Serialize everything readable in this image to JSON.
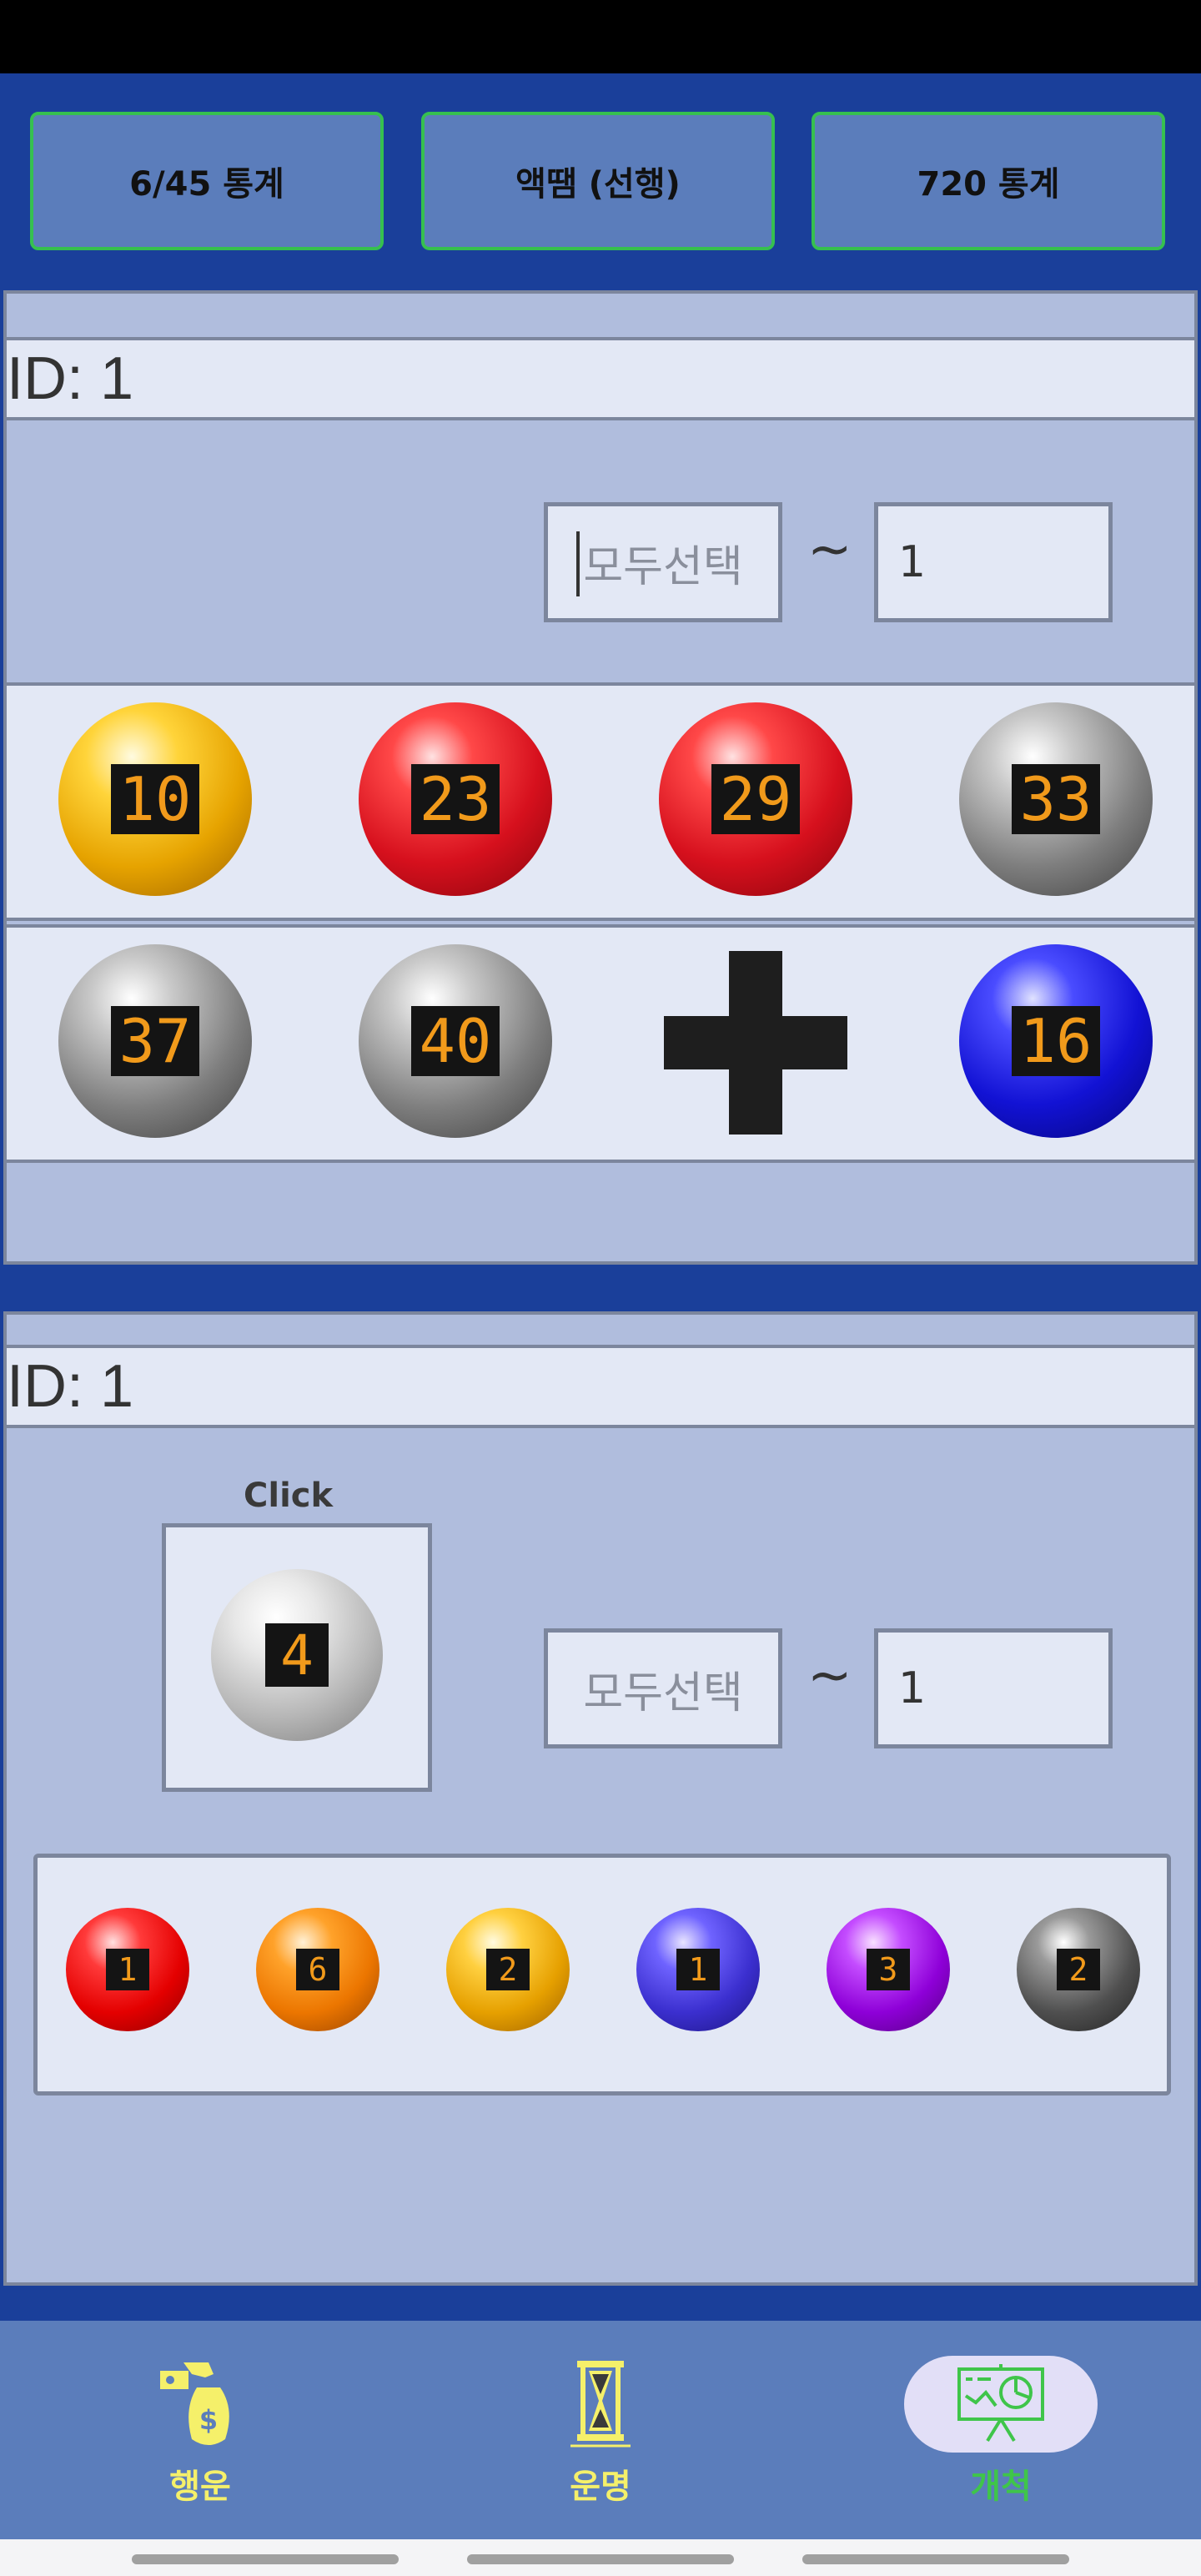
{
  "tabs": {
    "tab1": "6/45 통계",
    "tab2": "액땜 (선행)",
    "tab3": "720 통계"
  },
  "panel1": {
    "id_text": "ID: 1",
    "select_placeholder": "모두선택",
    "tilde": "~",
    "count_value": "1",
    "row1": [
      {
        "num": "10",
        "color": "gold"
      },
      {
        "num": "23",
        "color": "red"
      },
      {
        "num": "29",
        "color": "red"
      },
      {
        "num": "33",
        "color": "gray"
      }
    ],
    "row2": [
      {
        "num": "37",
        "color": "gray"
      },
      {
        "num": "40",
        "color": "gray"
      },
      {
        "num": "16",
        "color": "blue"
      }
    ],
    "plus_icon": "plus-icon"
  },
  "panel2": {
    "id_text": "ID: 1",
    "click_label": "Click",
    "click_ball": "4",
    "select_placeholder": "모두선택",
    "tilde": "~",
    "count_value": "1",
    "balls": [
      {
        "num": "1",
        "color": "red"
      },
      {
        "num": "6",
        "color": "orange"
      },
      {
        "num": "2",
        "color": "gold"
      },
      {
        "num": "1",
        "color": "violet"
      },
      {
        "num": "3",
        "color": "purple"
      },
      {
        "num": "2",
        "color": "dark-gray"
      }
    ]
  },
  "nav": {
    "items": [
      {
        "label": "행운",
        "icon": "money-bag-icon",
        "color": "#f5f06a"
      },
      {
        "label": "운명",
        "icon": "hourglass-icon",
        "color": "#f5f06a"
      },
      {
        "label": "개척",
        "icon": "presentation-chart-icon",
        "color": "#3fc54a",
        "selected": true
      }
    ]
  },
  "colors": {
    "background": "#1a3f9a",
    "tab_border": "#36c04f",
    "ball_number": "#f19a1b"
  }
}
